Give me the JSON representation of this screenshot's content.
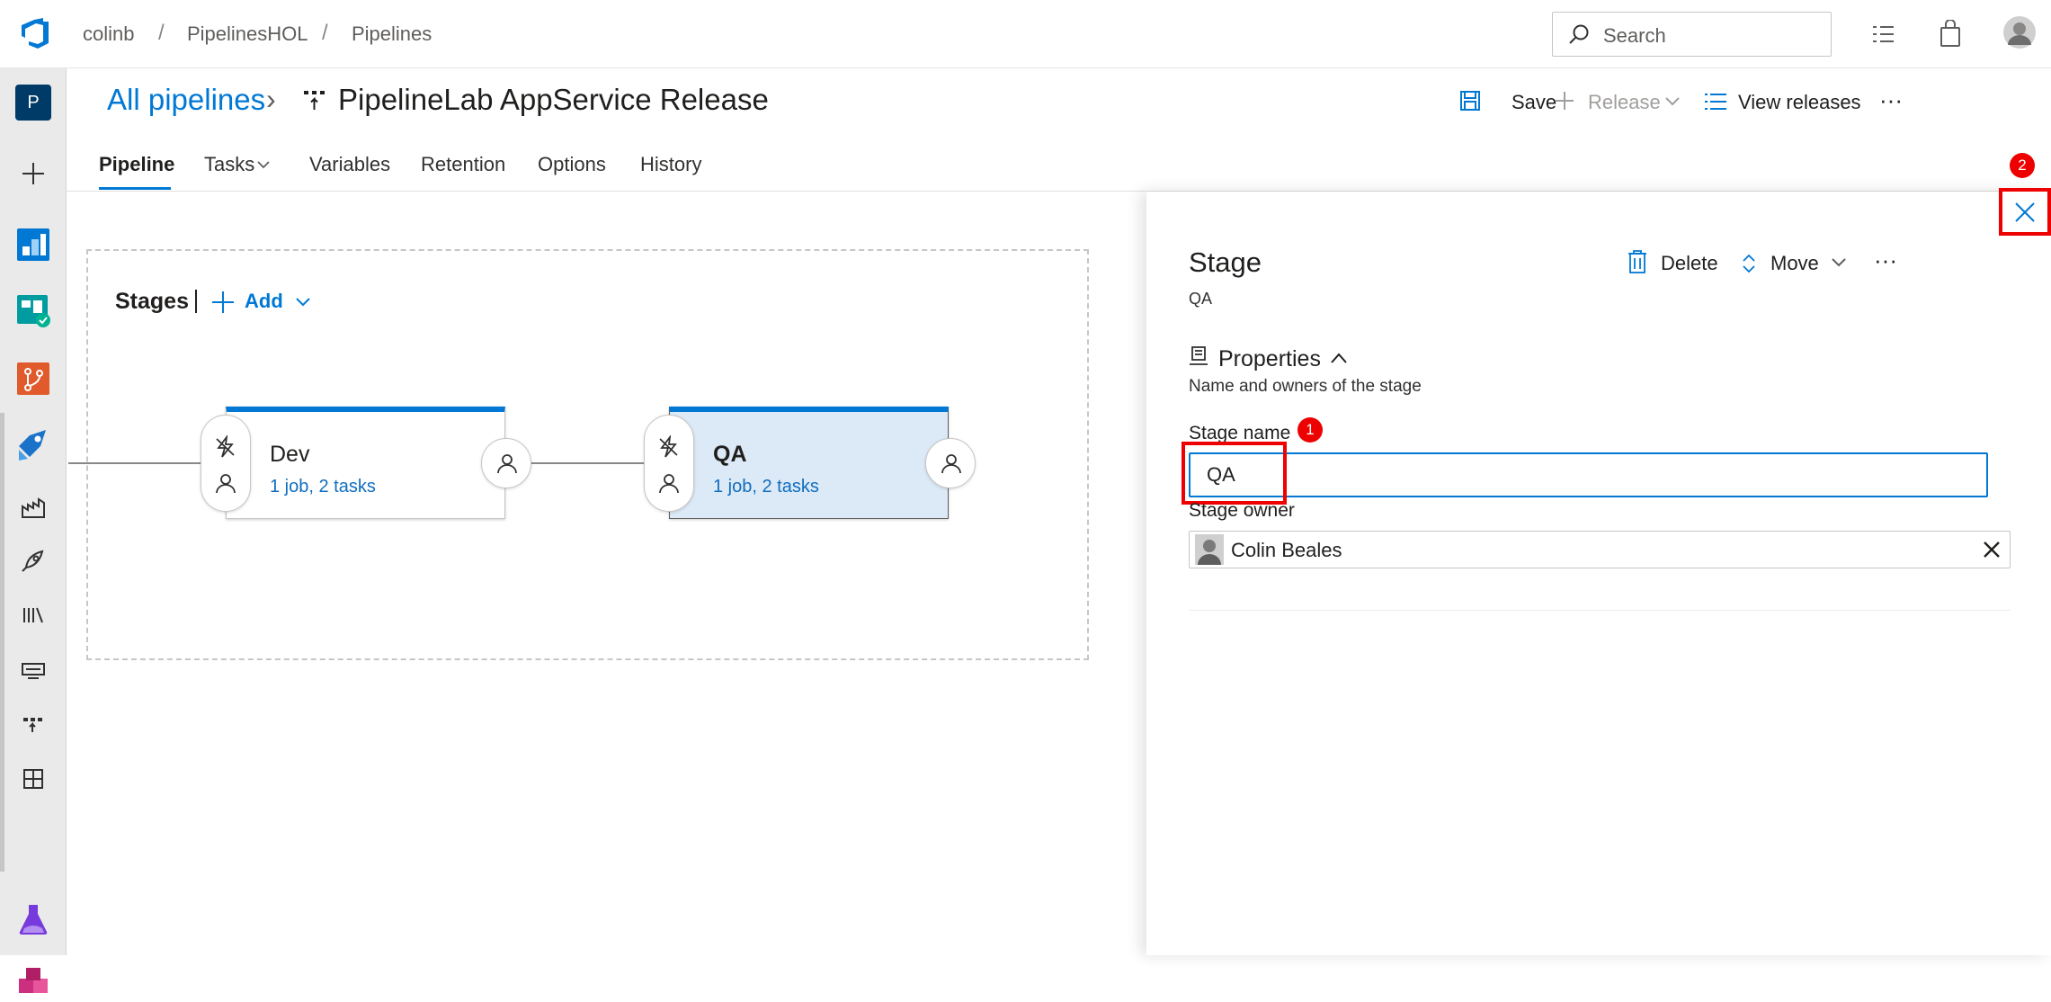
{
  "breadcrumb": {
    "org": "colinb",
    "project": "PipelinesHOL",
    "section": "Pipelines",
    "separator": "/"
  },
  "search": {
    "placeholder": "Search"
  },
  "leftnav": {
    "project_initial": "P",
    "items": [
      "overview-icon",
      "boards-icon",
      "repos-icon",
      "pipelines-icon",
      "builds-icon",
      "releases-icon",
      "library-icon",
      "task-groups-icon",
      "deployment-groups-icon",
      "xaml-icon",
      "test-plans-icon",
      "artifacts-icon"
    ]
  },
  "header": {
    "all_pipelines": "All pipelines",
    "chevron": "›",
    "title": "PipelineLab AppService Release",
    "actions": {
      "save": "Save",
      "release": "Release",
      "view_releases": "View releases",
      "more": "···"
    }
  },
  "tabs": [
    "Pipeline",
    "Tasks",
    "Variables",
    "Retention",
    "Options",
    "History"
  ],
  "canvas": {
    "stages_label": "Stages",
    "add_label": "Add",
    "stages": [
      {
        "name": "Dev",
        "summary": "1 job, 2 tasks",
        "selected": false
      },
      {
        "name": "QA",
        "summary": "1 job, 2 tasks",
        "selected": true
      }
    ]
  },
  "panel": {
    "title": "Stage",
    "subtitle": "QA",
    "actions": {
      "delete": "Delete",
      "move": "Move",
      "more": "···"
    },
    "properties": {
      "label": "Properties",
      "description": "Name and owners of the stage"
    },
    "stage_name": {
      "label": "Stage name",
      "value": "QA"
    },
    "stage_owner": {
      "label": "Stage owner",
      "value": "Colin Beales"
    }
  },
  "callouts": {
    "badge_1": "1",
    "badge_2": "2"
  },
  "colors": {
    "accent": "#0078d4",
    "callout": "#e00000",
    "selected_stage": "#dce9f6"
  }
}
